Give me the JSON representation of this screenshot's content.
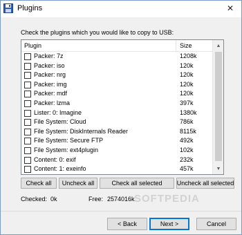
{
  "window": {
    "title": "Plugins",
    "close_glyph": "✕"
  },
  "instruction": "Check the plugins which you would like to copy to USB:",
  "list": {
    "columns": {
      "plugin": "Plugin",
      "size": "Size"
    },
    "rows": [
      {
        "name": "Packer: 7z",
        "size": "1208k",
        "checked": false
      },
      {
        "name": "Packer: iso",
        "size": "120k",
        "checked": false
      },
      {
        "name": "Packer: nrg",
        "size": "120k",
        "checked": false
      },
      {
        "name": "Packer: img",
        "size": "120k",
        "checked": false
      },
      {
        "name": "Packer: mdf",
        "size": "120k",
        "checked": false
      },
      {
        "name": "Packer: lzma",
        "size": "397k",
        "checked": false
      },
      {
        "name": "Lister: 0: Imagine",
        "size": "1380k",
        "checked": false
      },
      {
        "name": "File System: Cloud",
        "size": "786k",
        "checked": false
      },
      {
        "name": "File System: DiskInternals Reader",
        "size": "8115k",
        "checked": false
      },
      {
        "name": "File System: Secure FTP",
        "size": "492k",
        "checked": false
      },
      {
        "name": "File System: ext4plugin",
        "size": "102k",
        "checked": false
      },
      {
        "name": "Content: 0: exif",
        "size": "232k",
        "checked": false
      },
      {
        "name": "Content: 1: exeinfo",
        "size": "457k",
        "checked": false
      }
    ]
  },
  "buttons": {
    "check_all": "Check all",
    "uncheck_all": "Uncheck all",
    "check_all_selected": "Check all selected",
    "uncheck_all_selected": "Uncheck all selected"
  },
  "status": {
    "checked_label": "Checked:",
    "checked_value": "0k",
    "free_label": "Free:",
    "free_value": "2574016k"
  },
  "nav": {
    "back": "< Back",
    "next": "Next >",
    "cancel": "Cancel"
  },
  "watermark": "SOFTPEDIA",
  "colors": {
    "accent": "#0078d7",
    "title_bg": "#ffffff",
    "window_bg": "#f0f0f0"
  }
}
